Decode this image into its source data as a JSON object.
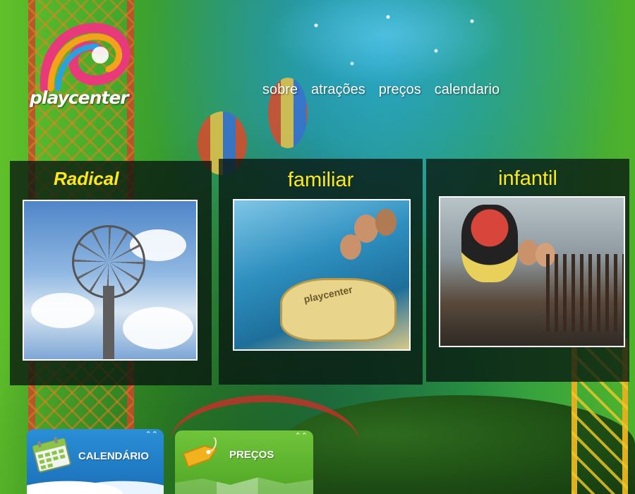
{
  "brand": {
    "name": "playcenter"
  },
  "nav": {
    "items": [
      {
        "label": "sobre"
      },
      {
        "label": "atrações"
      },
      {
        "label": "preços"
      },
      {
        "label": "calendario"
      }
    ]
  },
  "categories": [
    {
      "title": "Radical"
    },
    {
      "title": "familiar",
      "photo_text": "playcenter"
    },
    {
      "title": "infantil"
    }
  ],
  "tabs": {
    "calendar": {
      "label": "CALENDÁRIO",
      "arrow": "⌃⌃"
    },
    "prices": {
      "label": "PREÇOS",
      "arrow": "⌃⌃"
    }
  },
  "colors": {
    "panel_title": "#ffe81a",
    "calendar_tab": "#2a8fd6",
    "prices_tab": "#6fc43a"
  }
}
